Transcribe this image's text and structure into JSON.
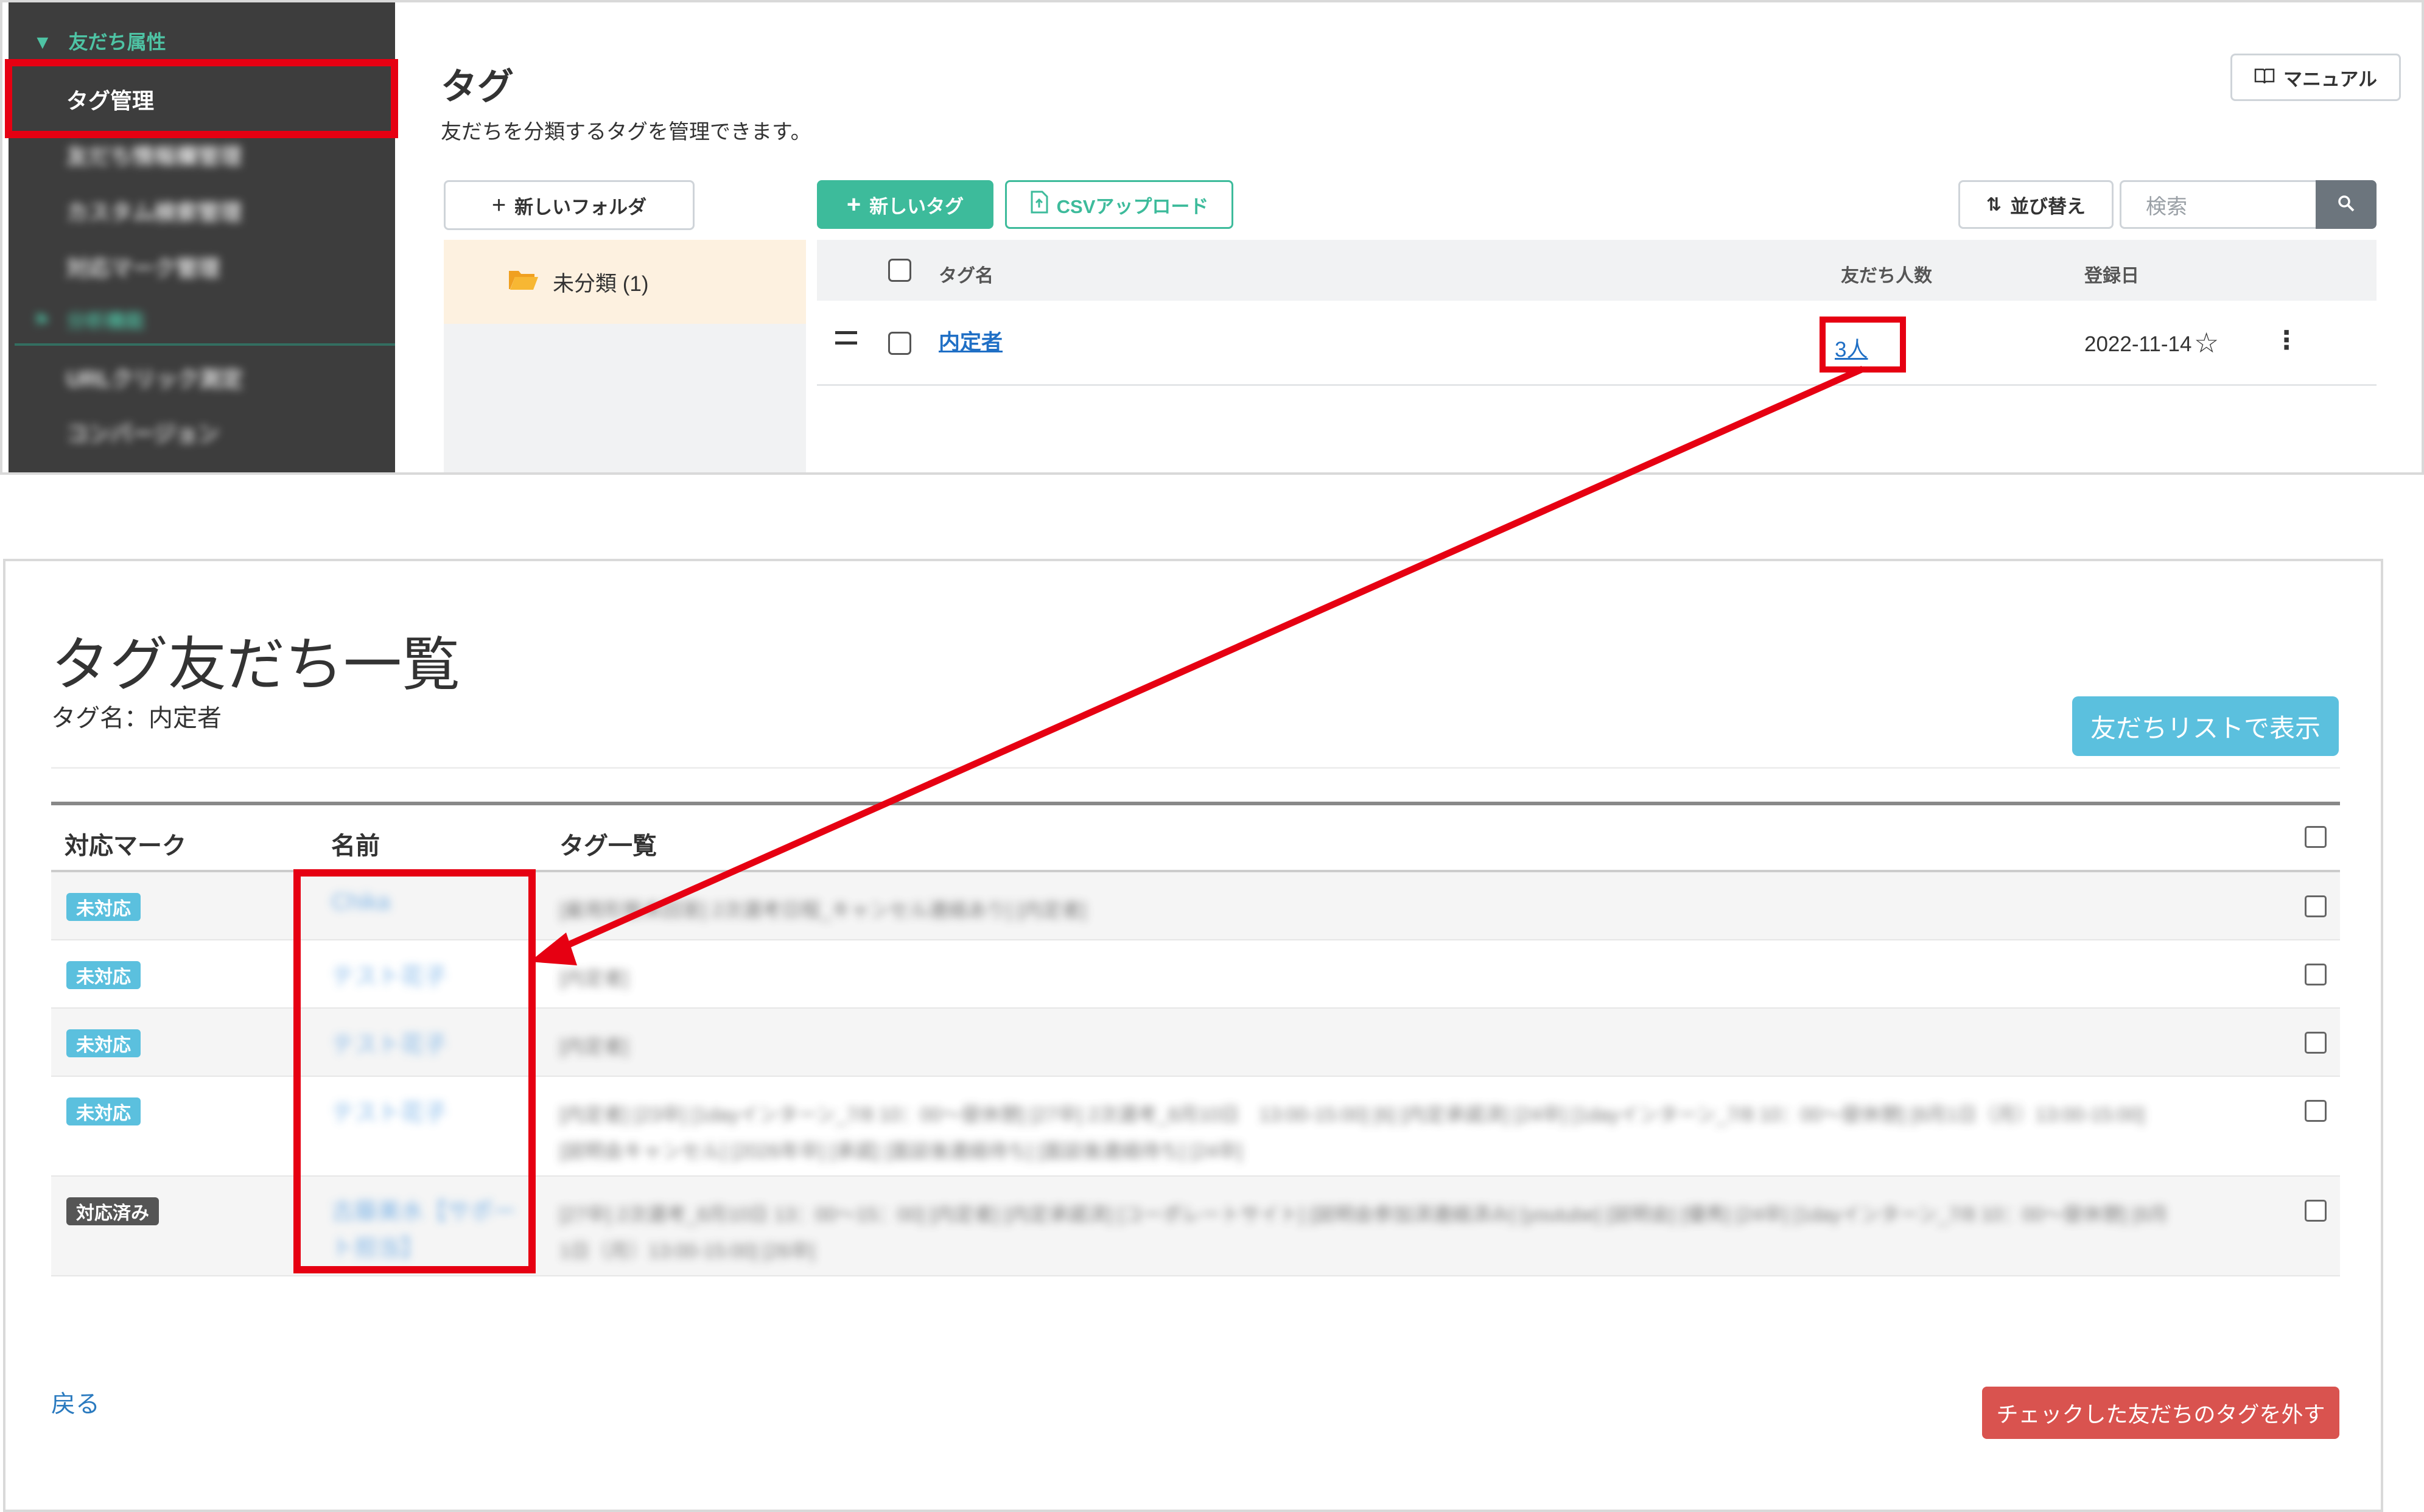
{
  "sidebar": {
    "section_label": "友だち属性",
    "active_item": "タグ管理",
    "blurred_items": [
      "友だち情報欄管理",
      "カスタム検索管理",
      "対応マーク管理"
    ],
    "section2_label": "分析機能",
    "blurred_items2": [
      "URLクリック測定",
      "コンバージョン"
    ]
  },
  "tag_page": {
    "title": "タグ",
    "description": "友だちを分類するタグを管理できます。",
    "manual_label": "マニュアル",
    "new_folder_label": "新しいフォルダ",
    "new_tag_label": "新しいタグ",
    "csv_label": "CSVアップロード",
    "sort_label": "並び替え",
    "search_placeholder": "検索",
    "folder": {
      "name": "未分類 (1)"
    },
    "table": {
      "headers": {
        "name": "タグ名",
        "count": "友だち人数",
        "date": "登録日"
      },
      "rows": [
        {
          "name": "内定者",
          "count": "3人",
          "date": "2022-11-14"
        }
      ]
    }
  },
  "tag_friends": {
    "title": "タグ友だち一覧",
    "tag_name_line": "タグ名：内定者",
    "show_list_label": "友だちリストで表示",
    "headers": {
      "mark": "対応マーク",
      "name": "名前",
      "tags": "タグ一覧"
    },
    "rows": [
      {
        "mark": "未対応",
        "name": "Chika",
        "tags": "[雇用形態未回答] 2次選考日程_キャンセル連絡あり] [内定者]"
      },
      {
        "mark": "未対応",
        "name": "テスト花子",
        "tags": "[内定者]"
      },
      {
        "mark": "未対応",
        "name": "テスト花子",
        "tags": "[内定者]"
      },
      {
        "mark": "未対応",
        "name": "テスト花子",
        "tags": "[内定者] [23卒] [1dayインターン_7/8 10：00〜昼休憩] [27卒] 2次選考_8月10日　13:00-15:00] [6] [内定承諾済] [24卒] [1dayインターン_7/8 10：00〜昼休憩] [8月1日（月）13:00-15:00] [説明会キャンセル] [2026年卒] [承諾] [面談後連絡待ち] [面談後連絡待ち] [24卒]"
      },
      {
        "mark": "対応済み",
        "name": "古藤美水【サポート担当】",
        "tags": "[27卒] 2次選考_8月10日 13：00〜15：00] [内定者] [内定承諾済] [コーポレートサイト] [説明会参加済連絡済み] [youtube] [説明会] [優秀] [24卒] [1dayインターン_7/8 10：00〜昼休憩] [8月1日（月）13:00-15:00] [26卒]"
      }
    ],
    "back_label": "戻る",
    "remove_label": "チェックした友だちのタグを外す"
  },
  "colors": {
    "highlight": "#e60012",
    "accent_green": "#3dbb9b",
    "info_blue": "#5bc0de",
    "danger_red": "#d9534f"
  }
}
